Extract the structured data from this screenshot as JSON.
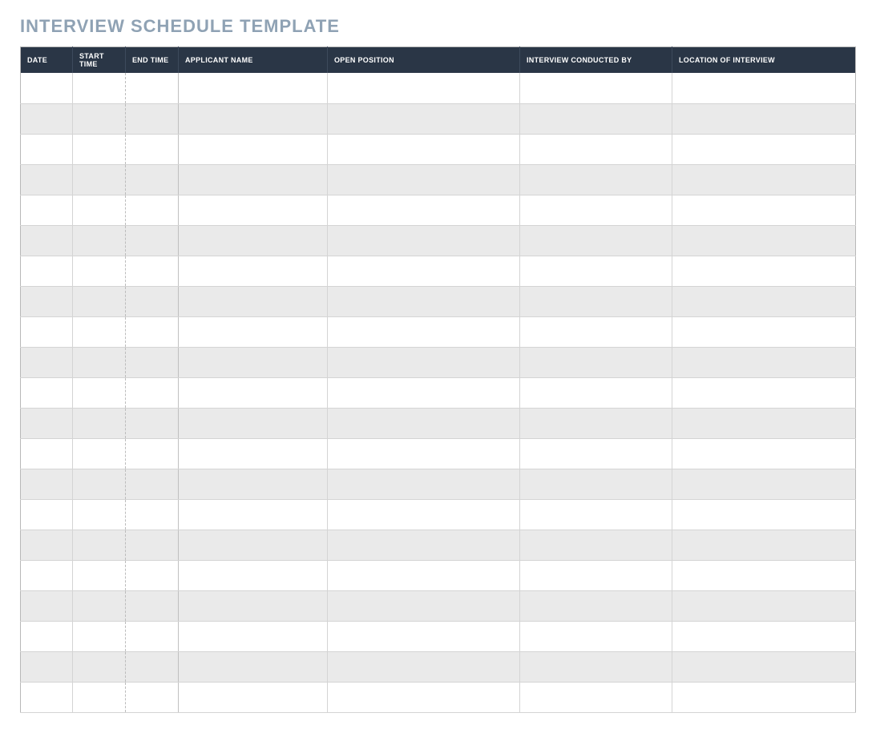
{
  "title": "INTERVIEW SCHEDULE TEMPLATE",
  "table": {
    "headers": {
      "date": "DATE",
      "start_time": "START TIME",
      "end_time": "END TIME",
      "applicant_name": "APPLICANT NAME",
      "open_position": "OPEN POSITION",
      "interview_conducted_by": "INTERVIEW CONDUCTED BY",
      "location_of_interview": "LOCATION OF INTERVIEW"
    },
    "rows": [
      {
        "date": "",
        "start_time": "",
        "end_time": "",
        "applicant_name": "",
        "open_position": "",
        "interview_conducted_by": "",
        "location_of_interview": ""
      },
      {
        "date": "",
        "start_time": "",
        "end_time": "",
        "applicant_name": "",
        "open_position": "",
        "interview_conducted_by": "",
        "location_of_interview": ""
      },
      {
        "date": "",
        "start_time": "",
        "end_time": "",
        "applicant_name": "",
        "open_position": "",
        "interview_conducted_by": "",
        "location_of_interview": ""
      },
      {
        "date": "",
        "start_time": "",
        "end_time": "",
        "applicant_name": "",
        "open_position": "",
        "interview_conducted_by": "",
        "location_of_interview": ""
      },
      {
        "date": "",
        "start_time": "",
        "end_time": "",
        "applicant_name": "",
        "open_position": "",
        "interview_conducted_by": "",
        "location_of_interview": ""
      },
      {
        "date": "",
        "start_time": "",
        "end_time": "",
        "applicant_name": "",
        "open_position": "",
        "interview_conducted_by": "",
        "location_of_interview": ""
      },
      {
        "date": "",
        "start_time": "",
        "end_time": "",
        "applicant_name": "",
        "open_position": "",
        "interview_conducted_by": "",
        "location_of_interview": ""
      },
      {
        "date": "",
        "start_time": "",
        "end_time": "",
        "applicant_name": "",
        "open_position": "",
        "interview_conducted_by": "",
        "location_of_interview": ""
      },
      {
        "date": "",
        "start_time": "",
        "end_time": "",
        "applicant_name": "",
        "open_position": "",
        "interview_conducted_by": "",
        "location_of_interview": ""
      },
      {
        "date": "",
        "start_time": "",
        "end_time": "",
        "applicant_name": "",
        "open_position": "",
        "interview_conducted_by": "",
        "location_of_interview": ""
      },
      {
        "date": "",
        "start_time": "",
        "end_time": "",
        "applicant_name": "",
        "open_position": "",
        "interview_conducted_by": "",
        "location_of_interview": ""
      },
      {
        "date": "",
        "start_time": "",
        "end_time": "",
        "applicant_name": "",
        "open_position": "",
        "interview_conducted_by": "",
        "location_of_interview": ""
      },
      {
        "date": "",
        "start_time": "",
        "end_time": "",
        "applicant_name": "",
        "open_position": "",
        "interview_conducted_by": "",
        "location_of_interview": ""
      },
      {
        "date": "",
        "start_time": "",
        "end_time": "",
        "applicant_name": "",
        "open_position": "",
        "interview_conducted_by": "",
        "location_of_interview": ""
      },
      {
        "date": "",
        "start_time": "",
        "end_time": "",
        "applicant_name": "",
        "open_position": "",
        "interview_conducted_by": "",
        "location_of_interview": ""
      },
      {
        "date": "",
        "start_time": "",
        "end end,time": "",
        "applicant_name": "",
        "open_position": "",
        "interview_conducted_by": "",
        "location_of_interview": ""
      },
      {
        "date": "",
        "start_time": "",
        "end_time": "",
        "applicant_name": "",
        "open_position": "",
        "interview_conducted_by": "",
        "location_of_interview": ""
      },
      {
        "date": "",
        "start_time": "",
        "end_time": "",
        "applicant_name": "",
        "open_position": "",
        "interview_conducted_by": "",
        "location_of_interview": ""
      },
      {
        "date": "",
        "start_time": "",
        "end_time": "",
        "applicant_name": "",
        "open_position": "",
        "interview_conducted_by": "",
        "location_of_interview": ""
      },
      {
        "date": "",
        "start_time": "",
        "end_time": "",
        "applicant_name": "",
        "open_position": "",
        "interview_conducted_by": "",
        "location_of_interview": ""
      },
      {
        "date": "",
        "start_time": "",
        "end_time": "",
        "applicant_name": "",
        "open_position": "",
        "interview_conducted_by": "",
        "location_of_interview": ""
      }
    ]
  }
}
